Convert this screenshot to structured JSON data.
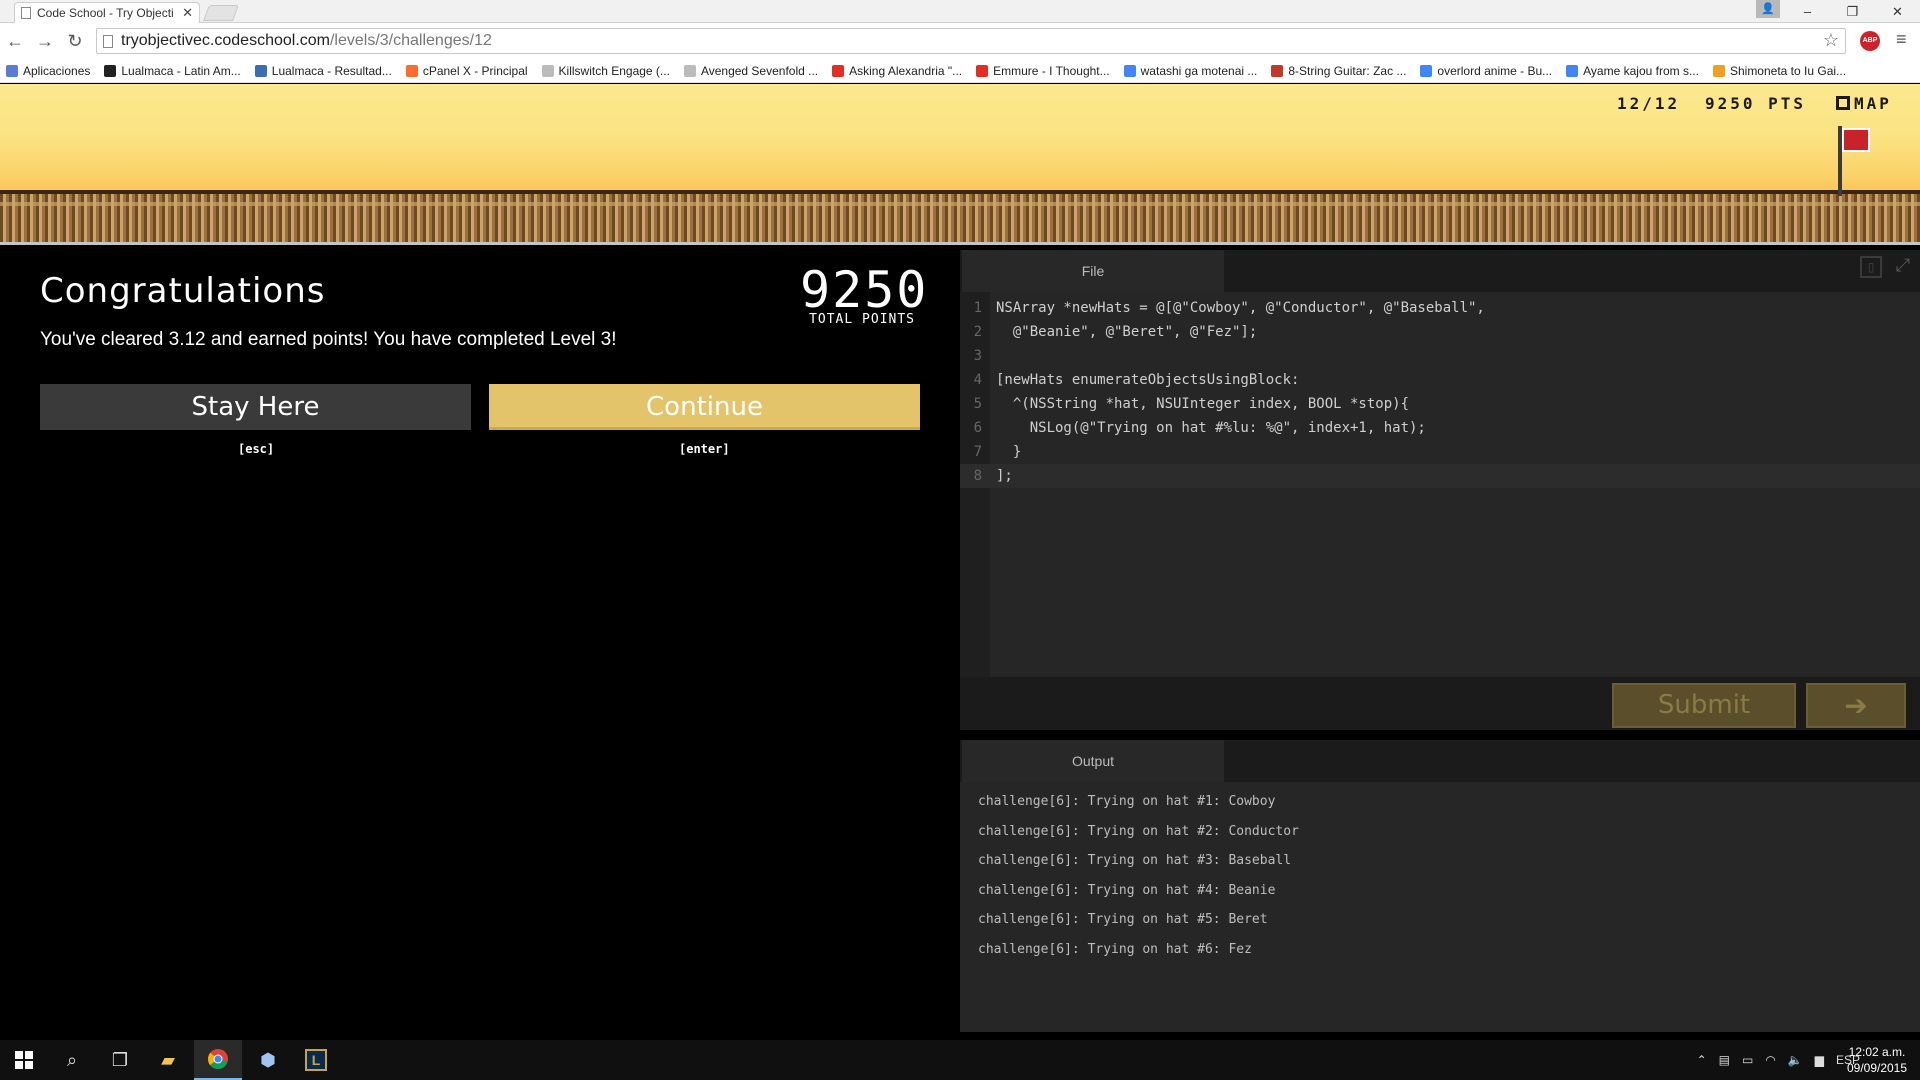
{
  "browser": {
    "tab_title": "Code School - Try Objecti",
    "tab_close": "✕",
    "url_host": "tryobjectivec.codeschool.com",
    "url_path": "/levels/3/challenges/12",
    "window_controls": [
      "–",
      "❐",
      "✕"
    ]
  },
  "bookmarks": [
    {
      "label": "Aplicaciones",
      "color": "#5b7bd6"
    },
    {
      "label": "Lualmaca - Latin Am...",
      "color": "#222222"
    },
    {
      "label": "Lualmaca - Resultad...",
      "color": "#3a6db5"
    },
    {
      "label": "cPanel X - Principal",
      "color": "#ff6c2c"
    },
    {
      "label": "Killswitch Engage (...",
      "color": "#bbbbbb"
    },
    {
      "label": "Avenged Sevenfold ...",
      "color": "#bbbbbb"
    },
    {
      "label": "Asking Alexandria \"...",
      "color": "#e52d27"
    },
    {
      "label": "Emmure - I Thought...",
      "color": "#e52d27"
    },
    {
      "label": "watashi ga motenai ...",
      "color": "#4285f4"
    },
    {
      "label": "8-String Guitar: Zac ...",
      "color": "#c0392b"
    },
    {
      "label": "overlord anime - Bu...",
      "color": "#4285f4"
    },
    {
      "label": "Ayame kajou from s...",
      "color": "#4285f4"
    },
    {
      "label": "Shimoneta to Iu Gai...",
      "color": "#f0a020"
    }
  ],
  "hud": {
    "progress": "12/12",
    "points": "9250 PTS",
    "map": "MAP"
  },
  "result": {
    "title": "Congratulations",
    "message": "You've cleared 3.12 and earned points! You have completed Level 3!",
    "total_points": "9250",
    "total_points_label": "TOTAL POINTS",
    "stay_label": "Stay Here",
    "stay_hint": "[esc]",
    "continue_label": "Continue",
    "continue_hint": "[enter]"
  },
  "editor": {
    "tab": "File",
    "lines": [
      {
        "n": "1",
        "text": "NSArray *newHats = @[@\"Cowboy\", @\"Conductor\", @\"Baseball\","
      },
      {
        "n": "2",
        "text": "  @\"Beanie\", @\"Beret\", @\"Fez\"];"
      },
      {
        "n": "3",
        "text": ""
      },
      {
        "n": "4",
        "text": "[newHats enumerateObjectsUsingBlock:"
      },
      {
        "n": "5",
        "text": "  ^(NSString *hat, NSUInteger index, BOOL *stop){"
      },
      {
        "n": "6",
        "text": "    NSLog(@\"Trying on hat #%lu: %@\", index+1, hat);"
      },
      {
        "n": "7",
        "text": "  }"
      },
      {
        "n": "8",
        "text": "];"
      }
    ],
    "submit_label": "Submit",
    "next_label": "➔"
  },
  "output": {
    "tab": "Output",
    "lines": [
      "challenge[6]: Trying on hat #1: Cowboy",
      "challenge[6]: Trying on hat #2: Conductor",
      "challenge[6]: Trying on hat #3: Baseball",
      "challenge[6]: Trying on hat #4: Beanie",
      "challenge[6]: Trying on hat #5: Beret",
      "challenge[6]: Trying on hat #6: Fez"
    ]
  },
  "taskbar": {
    "language": "ESP",
    "time": "12:02 a.m.",
    "date": "09/09/2015"
  }
}
